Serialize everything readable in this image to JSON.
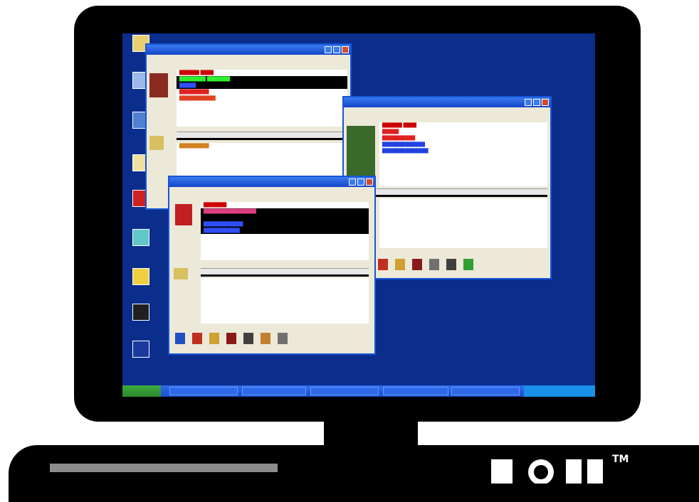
{
  "brand": {
    "logo_text": "DELL",
    "trademark": "TM"
  },
  "desktop": {
    "icons": [
      {
        "name": "my-documents-icon",
        "label": ""
      },
      {
        "name": "my-computer-icon",
        "label": ""
      },
      {
        "name": "network-icon",
        "label": ""
      },
      {
        "name": "people-icon",
        "label": ""
      },
      {
        "name": "recycle-icon",
        "label": ""
      },
      {
        "name": "program-icon",
        "label": ""
      },
      {
        "name": "folder-icon",
        "label": ""
      },
      {
        "name": "save-icon",
        "label": ""
      },
      {
        "name": "app-icon",
        "label": ""
      }
    ]
  },
  "windows": {
    "back": {
      "title": "",
      "menu": "",
      "toolbar_text": ""
    },
    "right": {
      "title": "",
      "menu": "",
      "toolbar_text": ""
    },
    "front": {
      "title": "",
      "menu": "",
      "toolbar_text": ""
    }
  },
  "taskbar": {
    "start_label": "",
    "tasks": [
      "",
      "",
      "",
      "",
      "",
      ""
    ],
    "clock": ""
  },
  "colors": {
    "desktop": "#0b2d8c",
    "title": "#1656d8",
    "taskbar": "#2d6cf0",
    "start": "#3fa83f"
  }
}
